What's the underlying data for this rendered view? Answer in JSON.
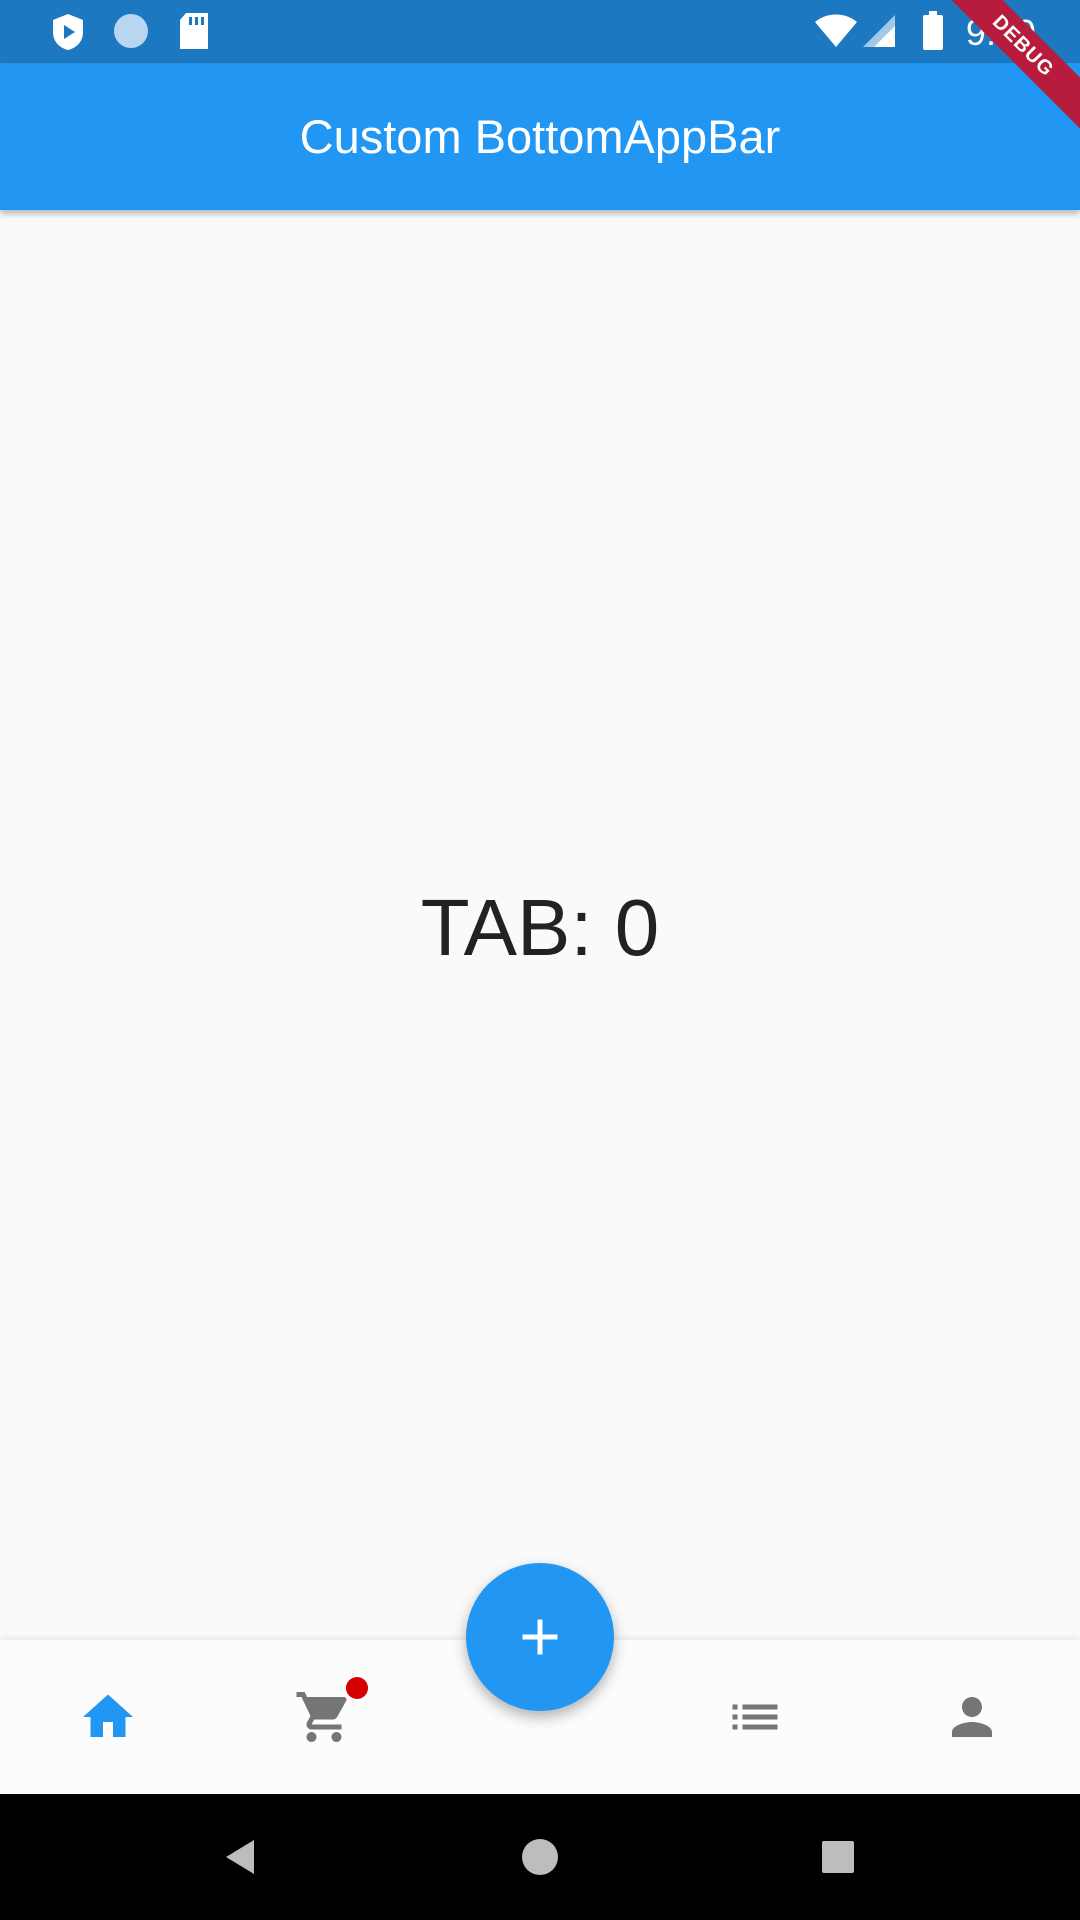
{
  "status_bar": {
    "time": "9:59",
    "left_icons": [
      "play-protect-icon",
      "sync-circle-icon",
      "sd-card-icon"
    ],
    "right_icons": [
      "wifi-icon",
      "cell-signal-icon",
      "battery-icon"
    ]
  },
  "debug_banner": "DEBUG",
  "app_bar": {
    "title": "Custom BottomAppBar",
    "color": "#2196f3"
  },
  "main": {
    "tab_label": "TAB: 0"
  },
  "bottom_bar": {
    "items": [
      {
        "icon": "home-icon",
        "selected": true,
        "color": "#2196f3"
      },
      {
        "icon": "shopping-cart-icon",
        "selected": false,
        "has_badge": true,
        "badge_color": "#d50000"
      },
      {
        "icon": "list-icon",
        "selected": false
      },
      {
        "icon": "person-icon",
        "selected": false
      }
    ],
    "fab_icon": "add-icon"
  },
  "system_nav": {
    "buttons": [
      "back-icon",
      "home-circle-icon",
      "recents-icon"
    ]
  }
}
